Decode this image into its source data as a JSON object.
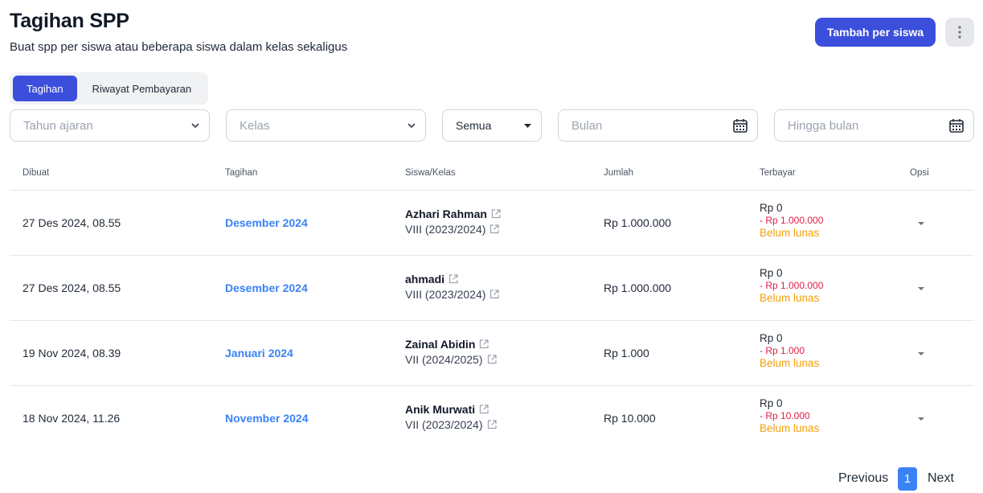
{
  "header": {
    "title": "Tagihan SPP",
    "subtitle": "Buat spp per siswa atau beberapa siswa dalam kelas sekaligus",
    "add_button": "Tambah per siswa",
    "more_icon": "kebab-vertical-icon"
  },
  "tabs": [
    {
      "label": "Tagihan",
      "active": true
    },
    {
      "label": "Riwayat Pembayaran",
      "active": false
    }
  ],
  "filters": {
    "year_placeholder": "Tahun ajaran",
    "class_placeholder": "Kelas",
    "status_value": "Semua",
    "month_placeholder": "Bulan",
    "until_placeholder": "Hingga bulan"
  },
  "table": {
    "headers": [
      "Dibuat",
      "Tagihan",
      "Siswa/Kelas",
      "Jumlah",
      "Terbayar",
      "Opsi"
    ],
    "rows": [
      {
        "created": "27 Des 2024, 08.55",
        "bill": "Desember 2024",
        "student": "Azhari Rahman",
        "class": "VIII (2023/2024)",
        "amount": "Rp 1.000.000",
        "paid": "Rp 0",
        "remaining": "- Rp 1.000.000",
        "status": "Belum lunas"
      },
      {
        "created": "27 Des 2024, 08.55",
        "bill": "Desember 2024",
        "student": "ahmadi",
        "class": "VIII (2023/2024)",
        "amount": "Rp 1.000.000",
        "paid": "Rp 0",
        "remaining": "- Rp 1.000.000",
        "status": "Belum lunas"
      },
      {
        "created": "19 Nov 2024, 08.39",
        "bill": "Januari 2024",
        "student": "Zainal Abidin",
        "class": "VII (2024/2025)",
        "amount": "Rp 1.000",
        "paid": "Rp 0",
        "remaining": "- Rp 1.000",
        "status": "Belum lunas"
      },
      {
        "created": "18 Nov 2024, 11.26",
        "bill": "November 2024",
        "student": "Anik Murwati",
        "class": "VII (2023/2024)",
        "amount": "Rp 10.000",
        "paid": "Rp 0",
        "remaining": "- Rp 10.000",
        "status": "Belum lunas"
      }
    ]
  },
  "pagination": {
    "previous": "Previous",
    "current": "1",
    "next": "Next"
  },
  "colors": {
    "primary": "#3b4fdc",
    "link": "#3b82f6",
    "danger": "#e11d48",
    "warning": "#f59e0b"
  }
}
